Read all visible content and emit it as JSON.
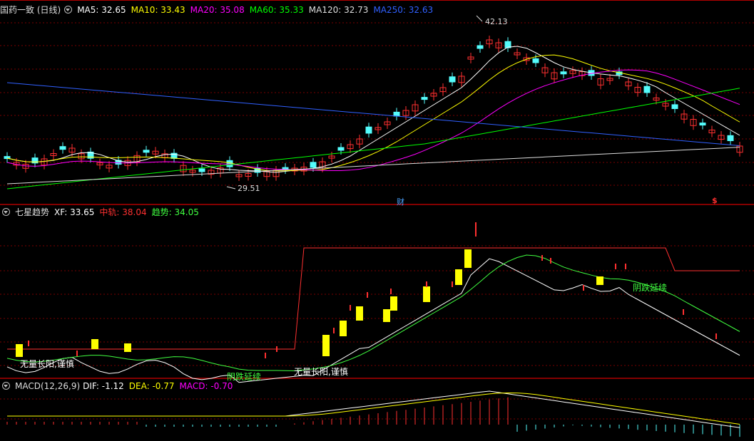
{
  "panels": {
    "price": {
      "title": "国药一致 (日线)",
      "ma": [
        {
          "label": "MA5: 32.65",
          "color": "#ffffff"
        },
        {
          "label": "MA10: 33.43",
          "color": "#ffff00"
        },
        {
          "label": "MA20: 35.08",
          "color": "#ff00ff"
        },
        {
          "label": "MA60: 35.33",
          "color": "#00ff00"
        },
        {
          "label": "MA120: 32.73",
          "color": "#dddddd"
        },
        {
          "label": "MA250: 32.63",
          "color": "#3060ff"
        }
      ],
      "high_marker": "42.13",
      "low_marker": "29.51",
      "event_markers": [
        "财",
        "$"
      ]
    },
    "trend": {
      "title": "七星趋势",
      "items": [
        {
          "label": "XF: 33.65",
          "color": "#ffffff"
        },
        {
          "label": "中轨: 38.04",
          "color": "#ff3030"
        },
        {
          "label": "趋势: 34.05",
          "color": "#40ff40"
        }
      ],
      "annotations": [
        {
          "text": "无量长阳,谨慎",
          "color": "#ffffff"
        },
        {
          "text": "阴跌延续",
          "color": "#40ff40"
        },
        {
          "text": "无量长阳,谨慎",
          "color": "#ffffff"
        },
        {
          "text": "阴跌延续",
          "color": "#40ff40"
        }
      ]
    },
    "macd": {
      "title": "MACD(12,26,9)",
      "items": [
        {
          "label": "DIF: -1.12",
          "color": "#ffffff"
        },
        {
          "label": "DEA: -0.77",
          "color": "#ffff00"
        },
        {
          "label": "MACD: -0.70",
          "color": "#ff00ff"
        }
      ]
    }
  },
  "colors": {
    "up": "#ff3030",
    "down": "#54fcfc",
    "grid": "#7a0000",
    "bg": "#000000",
    "highlight": "#ffff00"
  }
}
